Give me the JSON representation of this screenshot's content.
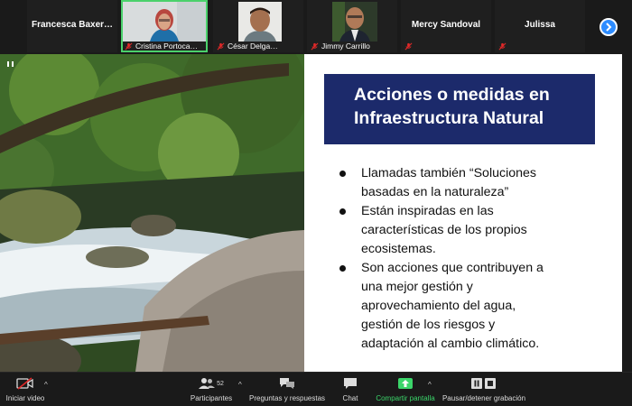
{
  "participants_strip": [
    {
      "name": "Francesca  Baxer…",
      "video": false
    },
    {
      "name": "Cristina Portoca…",
      "video": true,
      "active": true
    },
    {
      "name": "César Delga…",
      "video": true
    },
    {
      "name": "Jimmy Carrillo",
      "video": true
    },
    {
      "name": "Mercy Sandoval",
      "video": false
    },
    {
      "name": "Julissa",
      "video": false
    }
  ],
  "slide": {
    "title_line1": "Acciones o medidas en",
    "title_line2": "Infraestructura Natural",
    "bullets": [
      "Llamadas también “Soluciones\nbasadas en la naturaleza”",
      "Están inspiradas en las\ncaracterísticas de los propios\necosistemas.",
      "Son acciones que contribuyen a\nuna mejor gestión y\naprovechamiento del agua,\ngestión de los riesgos y\nadaptación al cambio climático."
    ]
  },
  "toolbar": {
    "start_video": "Iniciar video",
    "participants": "Participantes",
    "participants_count": "52",
    "qa": "Preguntas y respuestas",
    "chat": "Chat",
    "share_screen": "Compartir pantalla",
    "pause_recording": "Pausar/detener grabación"
  },
  "colors": {
    "title_bg": "#1c2a6b",
    "accent_blue": "#2d8cff",
    "share_green": "#3bd56a",
    "mute_red": "#e02828",
    "active_speaker": "#4bd16b"
  }
}
